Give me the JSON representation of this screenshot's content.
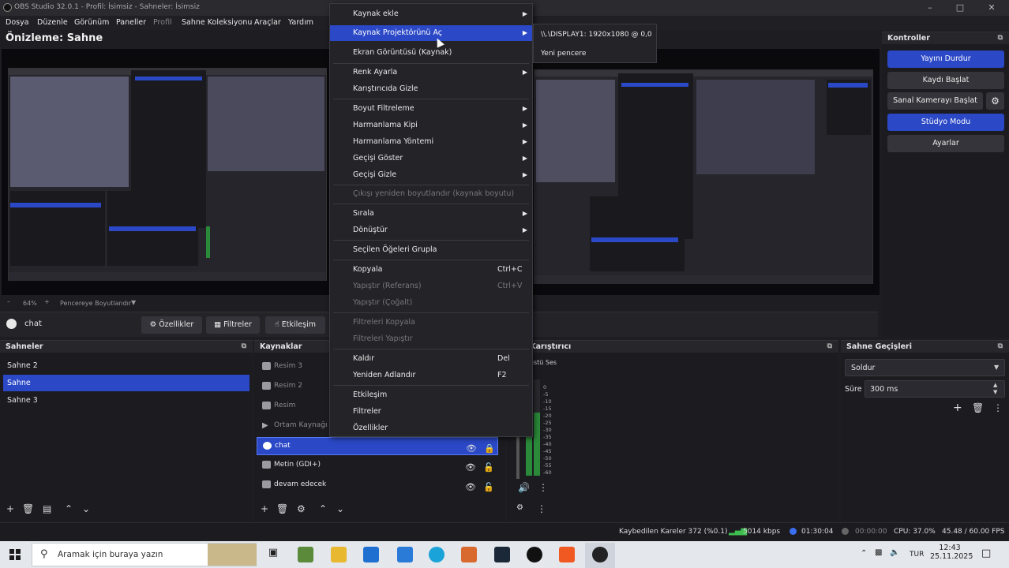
{
  "titlebar": {
    "title": "OBS Studio 32.0.1 - Profil: İsimsiz - Sahneler: İsimsiz"
  },
  "menubar": {
    "items": [
      "Dosya",
      "Düzenle",
      "Görünüm",
      "Paneller",
      "Profil",
      "Sahne Koleksiyonu",
      "Araçlar",
      "Yardım"
    ]
  },
  "preview": {
    "title": "Önizleme: Sahne",
    "zoom": "64%",
    "fit_label": "Pencereye Boyutlandır"
  },
  "source_toolbar": {
    "source_name": "chat",
    "properties": "Özellikler",
    "filters": "Filtreler",
    "interact": "Etkileşim"
  },
  "scenes": {
    "title": "Sahneler",
    "items": [
      "Sahne 2",
      "Sahne",
      "Sahne 3"
    ]
  },
  "sources": {
    "title": "Kaynaklar",
    "items": [
      "Resim 3",
      "Resim 2",
      "Resim",
      "Ortam Kaynağı",
      "chat",
      "Metin (GDI+)",
      "devam edecek"
    ]
  },
  "mixer": {
    "title": "Ses Karıştırıcı",
    "channel": "Masaüstü Ses",
    "scale": [
      "0",
      "-5",
      "-10",
      "-15",
      "-20",
      "-25",
      "-30",
      "-35",
      "-40",
      "-45",
      "-50",
      "-55",
      "-60"
    ]
  },
  "transitions": {
    "title": "Sahne Geçişleri",
    "type": "Soldur",
    "duration_label": "Süre",
    "duration_value": "300 ms"
  },
  "controls": {
    "title": "Kontroller",
    "stop_stream": "Yayını Durdur",
    "start_record": "Kaydı Başlat",
    "virtual_cam": "Sanal Kamerayı Başlat",
    "studio_mode": "Stüdyo Modu",
    "settings": "Ayarlar"
  },
  "context_menu": {
    "add_source": "Kaynak ekle",
    "open_projector": "Kaynak Projektörünü Aç",
    "screenshot": "Ekran Görüntüsü (Kaynak)",
    "color": "Renk Ayarla",
    "hide_mixer": "Karıştırıcıda Gizle",
    "scale_filter": "Boyut Filtreleme",
    "blend_mode": "Harmanlama Kipi",
    "blend_method": "Harmanlama Yöntemi",
    "show_transition": "Geçişi Göster",
    "hide_transition": "Geçişi Gizle",
    "resize_output": "Çıkışı yeniden boyutlandır (kaynak boyutu)",
    "order": "Sırala",
    "transform": "Dönüştür",
    "group": "Seçilen Öğeleri Grupla",
    "copy": "Kopyala",
    "copy_sc": "Ctrl+C",
    "paste_ref": "Yapıştır (Referans)",
    "paste_ref_sc": "Ctrl+V",
    "paste_dup": "Yapıştır (Çoğalt)",
    "copy_filters": "Filtreleri Kopyala",
    "paste_filters": "Filtreleri Yapıştır",
    "remove": "Kaldır",
    "remove_sc": "Del",
    "rename": "Yeniden Adlandır",
    "rename_sc": "F2",
    "interact": "Etkileşim",
    "filters": "Filtreler",
    "properties": "Özellikler"
  },
  "projector_submenu": {
    "display": "\\\\.\\DISPLAY1: 1920x1080 @ 0,0",
    "window": "Yeni pencere"
  },
  "status": {
    "dropped": "Kaybedilen Kareler 372 (%0.1)",
    "bitrate": "5014 kbps",
    "stream_time": "01:30:04",
    "rec_time": "00:00:00",
    "cpu": "CPU: 37.0%",
    "fps": "45.48 / 60.00 FPS"
  },
  "taskbar": {
    "search_placeholder": "Aramak için buraya yazın",
    "lang": "TUR",
    "time": "12:43",
    "date": "25.11.2025"
  },
  "colors": {
    "accent": "#2b48c6",
    "bg": "#1d1d22",
    "panel": "#1b1b20",
    "menu": "#232328"
  }
}
